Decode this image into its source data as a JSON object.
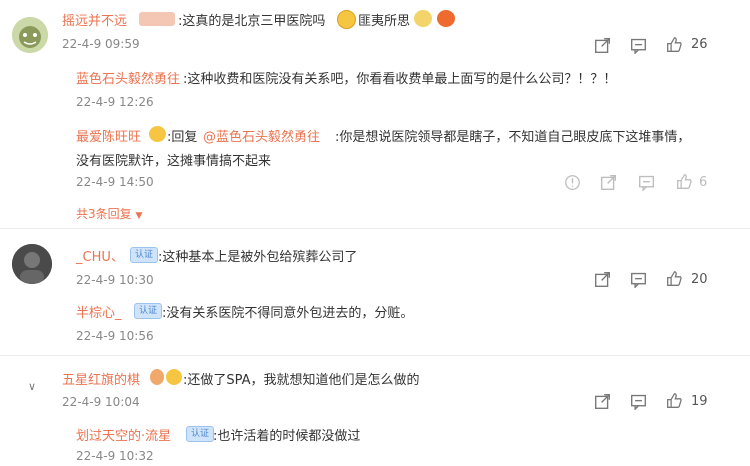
{
  "colors": {
    "username": "#eb7350",
    "body_text": "#333333",
    "time": "#888888",
    "icon": "#777777",
    "badge_bg": "#cfe3fb",
    "badge_text": "#4b86cf"
  },
  "comments": [
    {
      "user": "摇远并不远",
      "text": ":这真的是北京三甲医院吗",
      "text_suffix": "匪夷所思",
      "time": "22-4-9 09:59",
      "likes": "26",
      "replies": [
        {
          "user": "蓝色石头毅然勇往",
          "text": ":这种收费和医院没有关系吧，你看看收费单最上面写的是什么公司？！？！",
          "time": "22-4-9 12:26"
        },
        {
          "user": "最爱陈旺旺",
          "reply_prefix": ":回复",
          "mention": "@蓝色石头毅然勇往",
          "text": ":你是想说医院领导都是瞎子，不知道自己眼皮底下这堆事情，",
          "text_line2": "没有医院默许，这摊事情搞不起来",
          "time": "22-4-9 14:50",
          "likes": "6"
        }
      ],
      "more_replies": "共3条回复"
    },
    {
      "user": "_CHU、",
      "badge": "认证",
      "text": ":这种基本上是被外包给殡葬公司了",
      "time": "22-4-9 10:30",
      "likes": "20",
      "replies": [
        {
          "user": "半棕心_",
          "badge": "认证",
          "text": ":没有关系医院不得同意外包进去的，分赃。",
          "time": "22-4-9 10:56"
        }
      ]
    },
    {
      "user": "五星红旗的棋",
      "text": ":还做了SPA，我就想知道他们是怎么做的",
      "time": "22-4-9 10:04",
      "likes": "19",
      "replies": [
        {
          "user": "划过天空的·流星",
          "badge": "认证",
          "text": ":也许活着的时候都没做过",
          "time": "22-4-9 10:32"
        }
      ]
    }
  ]
}
